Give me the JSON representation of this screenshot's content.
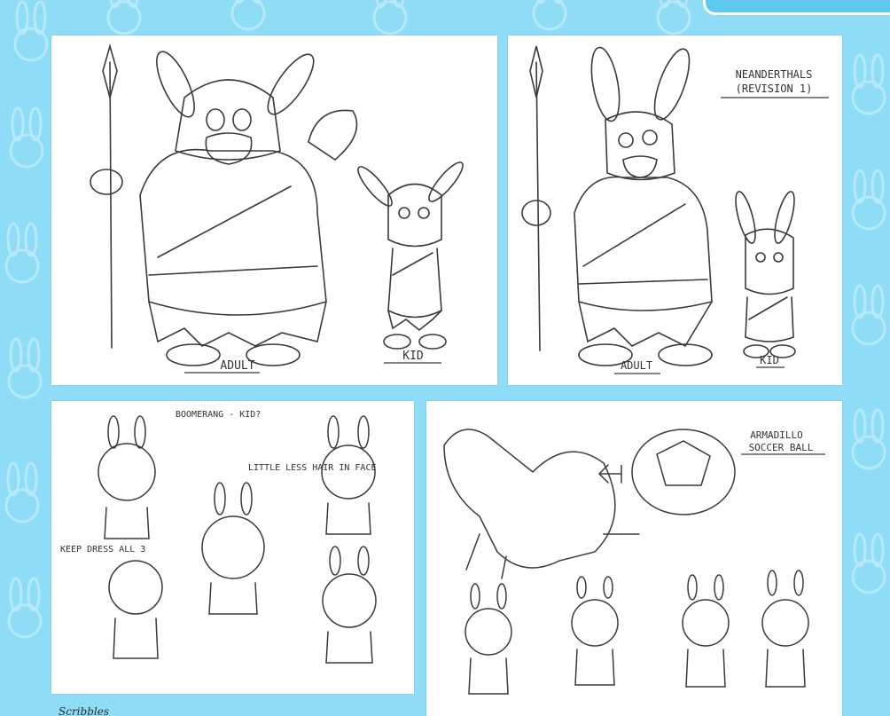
{
  "colors": {
    "background": "#8fdcf7",
    "tab": "#5fc8ef",
    "sketch_line": "#3a3a3a"
  },
  "gallery": {
    "sketch_1": {
      "labels": [
        "ADULT",
        "KID"
      ]
    },
    "sketch_2": {
      "title_line1": "NEANDERTHALS",
      "title_line2": "(REVISION 1)",
      "labels": [
        "ADULT",
        "KID"
      ]
    },
    "sketch_3": {
      "note_1": "BOOMERANG - KID?",
      "note_2": "LITTLE LESS HAIR IN FACE",
      "note_3": "KEEP DRESS ALL 3"
    },
    "sketch_4": {
      "title_line1": "ARMADILLO",
      "title_line2": "SOCCER BALL"
    }
  },
  "caption": "Scribbles"
}
